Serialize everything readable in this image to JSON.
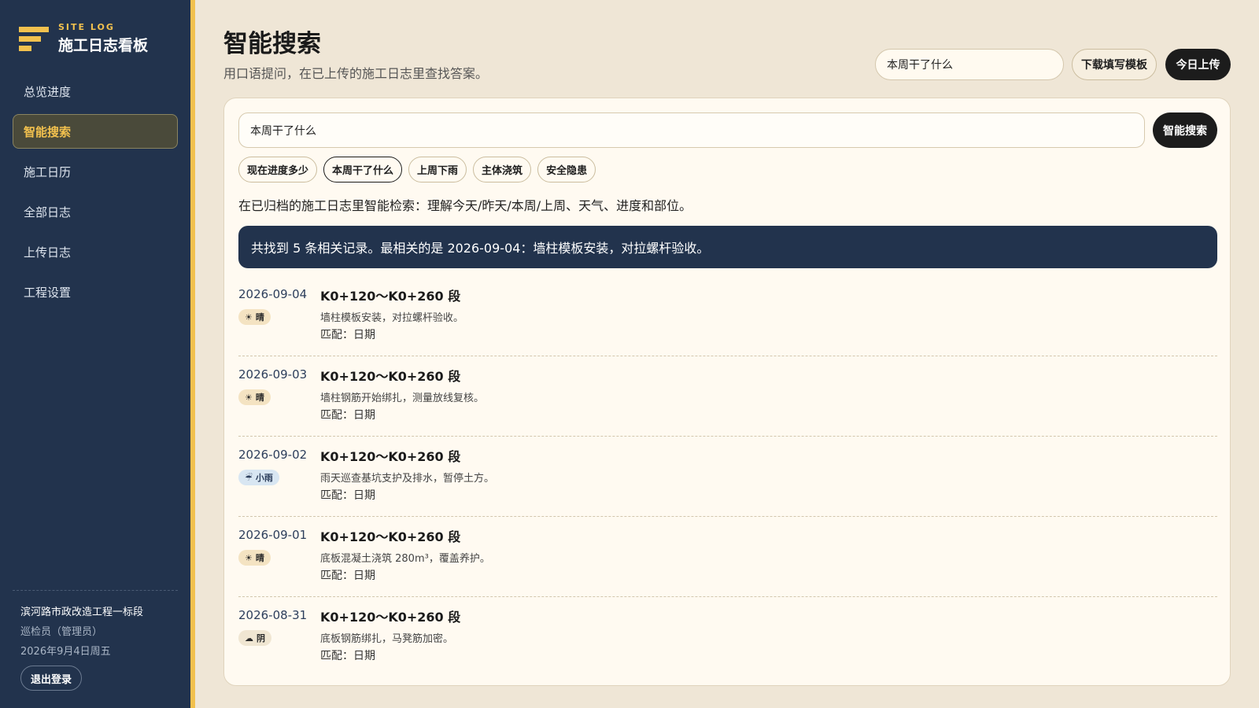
{
  "brand": {
    "eyebrow": "SITE LOG",
    "title": "施工日志看板"
  },
  "nav": [
    {
      "label": "总览进度",
      "active": false
    },
    {
      "label": "智能搜索",
      "active": true
    },
    {
      "label": "施工日历",
      "active": false
    },
    {
      "label": "全部日志",
      "active": false
    },
    {
      "label": "上传日志",
      "active": false
    },
    {
      "label": "工程设置",
      "active": false
    }
  ],
  "footer": {
    "project": "滨河路市政改造工程一标段",
    "role": "巡检员（管理员）",
    "date": "2026年9月4日周五",
    "logout_label": "退出登录"
  },
  "header": {
    "title": "智能搜索",
    "subtitle": "用口语提问，在已上传的施工日志里查找答案。",
    "search_value": "本周干了什么",
    "template_label": "下载填写模板",
    "upload_label": "今日上传"
  },
  "search": {
    "value": "本周干了什么",
    "button_label": "智能搜索",
    "chips": [
      {
        "label": "现在进度多少",
        "active": false
      },
      {
        "label": "本周干了什么",
        "active": true
      },
      {
        "label": "上周下雨",
        "active": false
      },
      {
        "label": "主体浇筑",
        "active": false
      },
      {
        "label": "安全隐患",
        "active": false
      }
    ],
    "description": "在已归档的施工日志里智能检索：理解今天/昨天/本周/上周、天气、进度和部位。",
    "summary": "共找到 5 条相关记录。最相关的是 2026-09-04：墙柱模板安装，对拉螺杆验收。"
  },
  "results": [
    {
      "date": "2026-09-04",
      "weather": "晴",
      "weather_icon": "sun-icon",
      "title": "K0+120～K0+260 段",
      "text": "墙柱模板安装，对拉螺杆验收。",
      "match": "匹配：日期"
    },
    {
      "date": "2026-09-03",
      "weather": "晴",
      "weather_icon": "sun-icon",
      "title": "K0+120～K0+260 段",
      "text": "墙柱钢筋开始绑扎，测量放线复核。",
      "match": "匹配：日期"
    },
    {
      "date": "2026-09-02",
      "weather": "小雨",
      "weather_icon": "rain-icon",
      "title": "K0+120～K0+260 段",
      "text": "雨天巡查基坑支护及排水，暂停土方。",
      "match": "匹配：日期"
    },
    {
      "date": "2026-09-01",
      "weather": "晴",
      "weather_icon": "sun-icon",
      "title": "K0+120～K0+260 段",
      "text": "底板混凝土浇筑 280m³，覆盖养护。",
      "match": "匹配：日期"
    },
    {
      "date": "2026-08-31",
      "weather": "阴",
      "weather_icon": "cloud-icon",
      "title": "K0+120～K0+260 段",
      "text": "底板钢筋绑扎，马凳筋加密。",
      "match": "匹配：日期"
    }
  ],
  "colors": {
    "sidebar": "#22334d",
    "accent": "#f2c14e",
    "background": "#efe6d6"
  }
}
